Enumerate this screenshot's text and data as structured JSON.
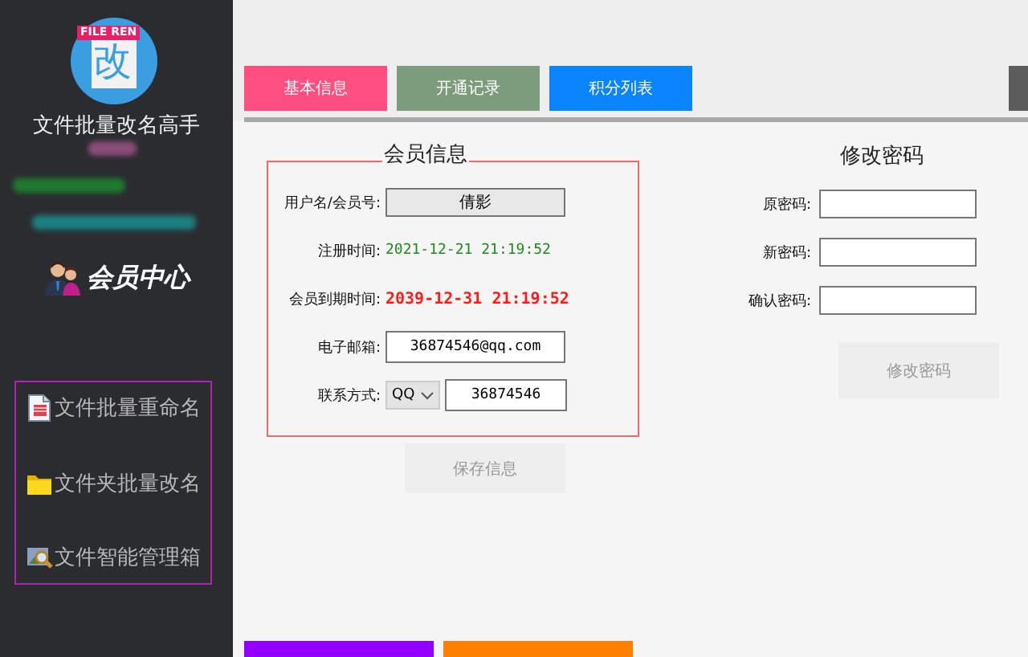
{
  "sidebar": {
    "logo": {
      "badge": "FILE REN",
      "glyph": "改"
    },
    "app_name": "文件批量改名高手",
    "blurred_lines": [
      {
        "color": "#8a4d78"
      },
      {
        "color": "#1f7a2e"
      },
      {
        "color": "#1d7f80"
      }
    ],
    "member_center": "会员中心",
    "menu": [
      {
        "label": "文件批量重命名",
        "kind": "document"
      },
      {
        "label": "文件夹批量改名",
        "kind": "folder"
      },
      {
        "label": "文件智能管理箱",
        "kind": "magnifier"
      }
    ]
  },
  "tabs": [
    {
      "label": "基本信息",
      "color": "#ff4f80"
    },
    {
      "label": "开通记录",
      "color": "#7d9c7c"
    },
    {
      "label": "积分列表",
      "color": "#0a84ff"
    },
    {
      "color": "#5c5c5c"
    }
  ],
  "member_info": {
    "title": "会员信息",
    "fields": [
      {
        "label": "用户名/会员号:",
        "kind": "button",
        "value": "倩影"
      },
      {
        "label": "注册时间:",
        "kind": "text",
        "value": "2021-12-21 21:19:52",
        "color": "#1d8a1d"
      },
      {
        "label": "会员到期时间:",
        "kind": "text",
        "value": "2039-12-31 21:19:52",
        "color": "#ff1a1a"
      },
      {
        "label": "电子邮箱:",
        "kind": "input",
        "value": "36874546@qq.com"
      },
      {
        "label": "联系方式:",
        "kind": "contact",
        "select": "QQ",
        "value": "36874546"
      }
    ],
    "save_button": {
      "label": "保存信息",
      "disabled": true
    }
  },
  "password": {
    "title": "修改密码",
    "fields": [
      {
        "label": "原密码:"
      },
      {
        "label": "新密码:"
      },
      {
        "label": "确认密码:"
      }
    ],
    "button": {
      "label": "修改密码",
      "disabled": true
    }
  },
  "bottom_buttons": [
    {
      "color": "#9400ff"
    },
    {
      "color": "#ff8000"
    }
  ]
}
